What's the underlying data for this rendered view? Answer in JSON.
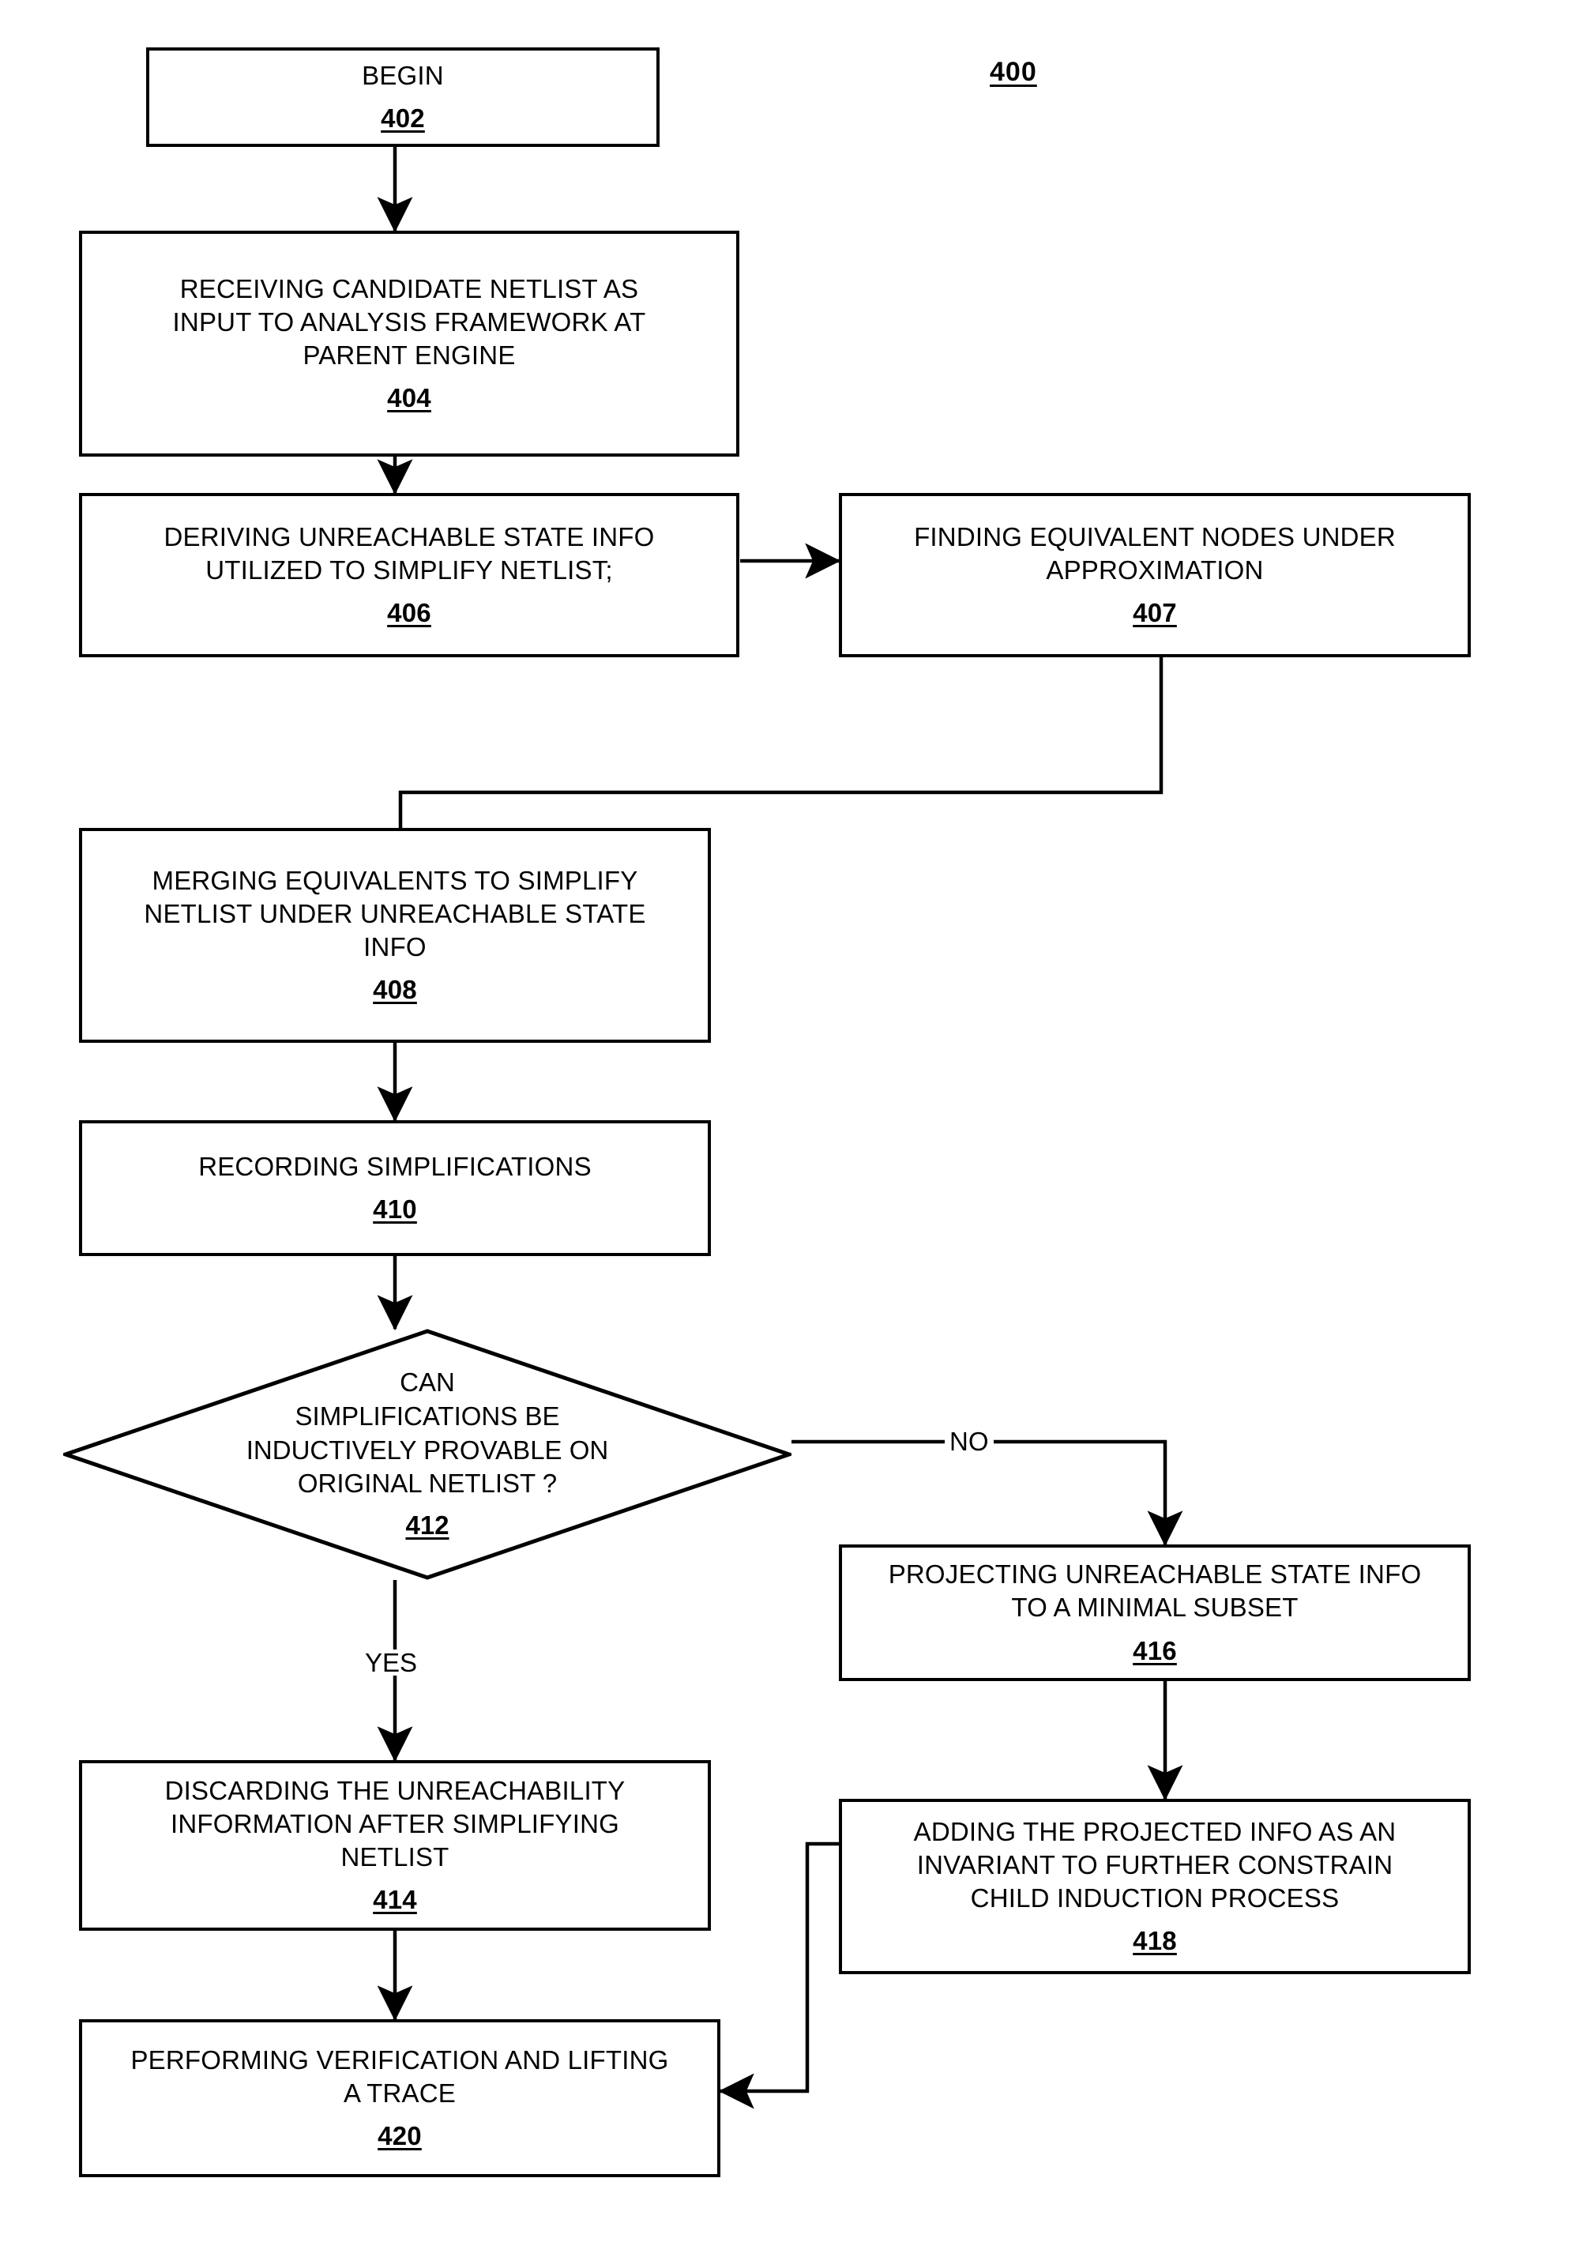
{
  "figure": {
    "number": "400"
  },
  "nodes": {
    "begin": {
      "text": "BEGIN",
      "ref": "402"
    },
    "receiving": {
      "text": "RECEIVING CANDIDATE NETLIST AS\nINPUT TO ANALYSIS FRAMEWORK AT\nPARENT ENGINE",
      "ref": "404"
    },
    "deriving": {
      "text": "DERIVING UNREACHABLE STATE INFO\nUTILIZED TO SIMPLIFY NETLIST;",
      "ref": "406"
    },
    "finding": {
      "text": "FINDING EQUIVALENT NODES UNDER\nAPPROXIMATION",
      "ref": "407"
    },
    "merging": {
      "text": "MERGING EQUIVALENTS TO SIMPLIFY\nNETLIST UNDER UNREACHABLE STATE\nINFO",
      "ref": "408"
    },
    "recording": {
      "text": "RECORDING SIMPLIFICATIONS",
      "ref": "410"
    },
    "decision": {
      "text": "CAN\nSIMPLIFICATIONS BE\nINDUCTIVELY PROVABLE ON\nORIGINAL NETLIST ?",
      "ref": "412"
    },
    "discarding": {
      "text": "DISCARDING THE UNREACHABILITY\nINFORMATION AFTER SIMPLIFYING\nNETLIST",
      "ref": "414"
    },
    "projecting": {
      "text": "PROJECTING UNREACHABLE STATE INFO\nTO A MINIMAL SUBSET",
      "ref": "416"
    },
    "adding": {
      "text": "ADDING THE PROJECTED INFO AS AN\nINVARIANT TO FURTHER CONSTRAIN\nCHILD INDUCTION PROCESS",
      "ref": "418"
    },
    "performing": {
      "text": "PERFORMING VERIFICATION AND LIFTING\nA TRACE",
      "ref": "420"
    }
  },
  "edge_labels": {
    "no": "NO",
    "yes": "YES"
  },
  "colors": {
    "stroke": "#000000",
    "background": "#ffffff"
  }
}
